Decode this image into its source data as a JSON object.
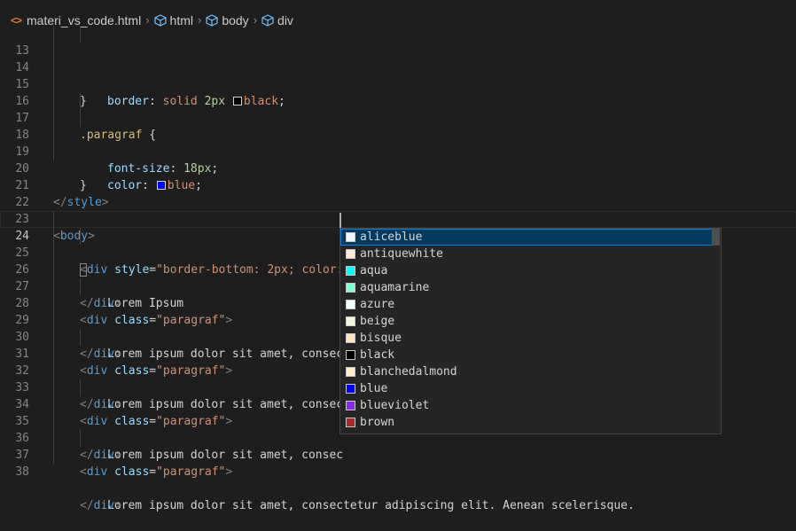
{
  "breadcrumb": {
    "file": "materi_vs_code.html",
    "items": [
      "html",
      "body",
      "div"
    ]
  },
  "code": {
    "l13": {
      "num": "13",
      "prop": "border",
      "colon": ": ",
      "v1": "solid",
      "n1": "2px",
      "color_name": "black",
      "end": ";"
    },
    "l14": {
      "num": "14",
      "brace": "}"
    },
    "l15": {
      "num": "15"
    },
    "l16": {
      "num": "16",
      "selector": ".paragraf",
      "brace": " {"
    },
    "l17": {
      "num": "17",
      "prop": "font-size",
      "colon": ": ",
      "value": "18px",
      "end": ";"
    },
    "l18": {
      "num": "18",
      "prop": "color",
      "colon": ": ",
      "color_name": "blue",
      "end": ";"
    },
    "l19": {
      "num": "19",
      "brace": "}"
    },
    "l20": {
      "num": "20"
    },
    "l21": {
      "num": "21",
      "open": "</",
      "name": "style",
      "close": ">"
    },
    "l22": {
      "num": "22"
    },
    "l23": {
      "num": "23",
      "open": "<",
      "name": "body",
      "close": ">"
    },
    "l24": {
      "num": "24",
      "open": "<",
      "name": "div",
      "attr": " style",
      "eq": "=",
      "str": "\"border-bottom: 2px; color:\"",
      "close": ">"
    },
    "l25": {
      "num": "25",
      "text": "Lorem Ipsum"
    },
    "l26": {
      "num": "26",
      "open": "</",
      "name": "div",
      "close": ">"
    },
    "l27": {
      "num": "27",
      "open": "<",
      "name": "div",
      "attr": " class",
      "eq": "=",
      "str": "\"paragraf\"",
      "close": ">"
    },
    "l28": {
      "num": "28",
      "text": "Lorem ipsum dolor sit amet, consec"
    },
    "l29": {
      "num": "29",
      "open": "</",
      "name": "div",
      "close": ">"
    },
    "l30": {
      "num": "30",
      "open": "<",
      "name": "div",
      "attr": " class",
      "eq": "=",
      "str": "\"paragraf\"",
      "close": ">"
    },
    "l31": {
      "num": "31",
      "text": "Lorem ipsum dolor sit amet, consec"
    },
    "l32": {
      "num": "32",
      "open": "</",
      "name": "div",
      "close": ">"
    },
    "l33": {
      "num": "33",
      "open": "<",
      "name": "div",
      "attr": " class",
      "eq": "=",
      "str": "\"paragraf\"",
      "close": ">"
    },
    "l34": {
      "num": "34",
      "text": "Lorem ipsum dolor sit amet, consec"
    },
    "l35": {
      "num": "35",
      "open": "</",
      "name": "div",
      "close": ">"
    },
    "l36": {
      "num": "36",
      "open": "<",
      "name": "div",
      "attr": " class",
      "eq": "=",
      "str": "\"paragraf\"",
      "close": ">"
    },
    "l37": {
      "num": "37",
      "text": "Lorem ipsum dolor sit amet, consectetur adipiscing elit. Aenean scelerisque."
    },
    "l38": {
      "num": "38",
      "open": "</",
      "name": "div",
      "close": ">"
    }
  },
  "suggest": {
    "items": [
      {
        "label": "aliceblue",
        "color": "#f0f8ff"
      },
      {
        "label": "antiquewhite",
        "color": "#faebd7"
      },
      {
        "label": "aqua",
        "color": "#00ffff"
      },
      {
        "label": "aquamarine",
        "color": "#7fffd4"
      },
      {
        "label": "azure",
        "color": "#f0ffff"
      },
      {
        "label": "beige",
        "color": "#f5f5dc"
      },
      {
        "label": "bisque",
        "color": "#ffe4c4"
      },
      {
        "label": "black",
        "color": "#000000"
      },
      {
        "label": "blanchedalmond",
        "color": "#ffebcd"
      },
      {
        "label": "blue",
        "color": "#0000ff"
      },
      {
        "label": "blueviolet",
        "color": "#8a2be2"
      },
      {
        "label": "brown",
        "color": "#a52a2a"
      }
    ]
  },
  "theme": {
    "editor_bg": "#1e1e1e",
    "selected_item_bg": "#04395e",
    "match_highlight": "#2aaaff"
  }
}
